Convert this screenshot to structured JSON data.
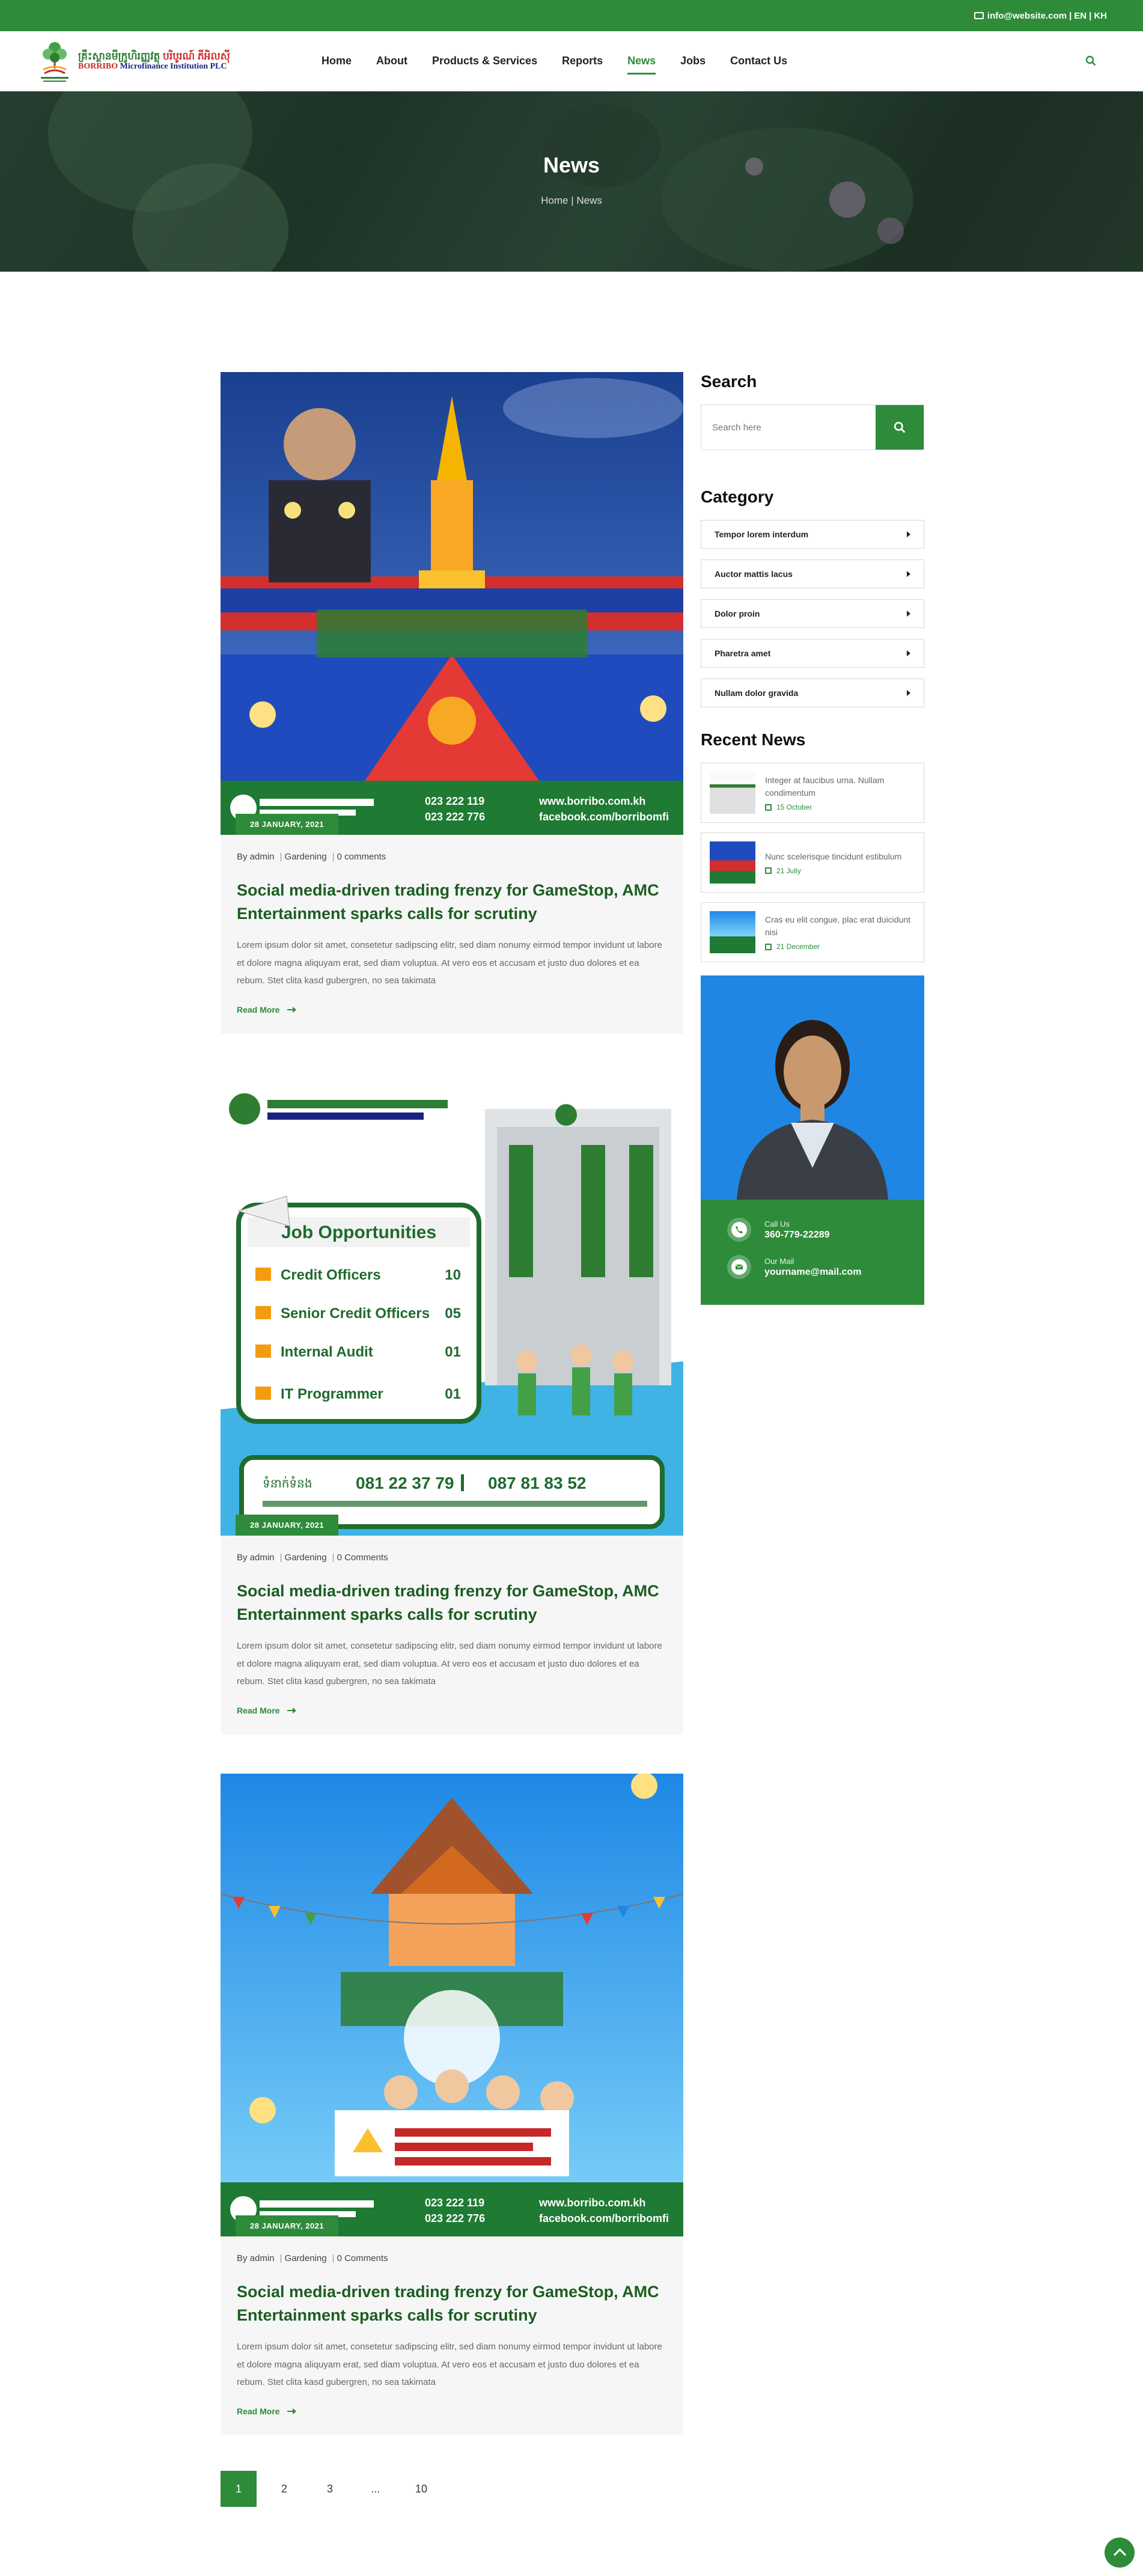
{
  "topbar": {
    "email": "info@website.com",
    "lang_en": "EN",
    "lang_kh": "KH",
    "separator": "|"
  },
  "logo": {
    "kh_text": "គ្រឹះស្ថានមីក្រូហិរញ្ញវត្ថុ",
    "kh_brand": "បរិបូរណ៍ ភីអិលស៊ី",
    "en_brand": "BORRIBO",
    "en_text": "Microfinance Institution PLC"
  },
  "nav": {
    "items": [
      "Home",
      "About",
      "Products & Services",
      "Reports",
      "News",
      "Jobs",
      "Contact Us"
    ],
    "active": "News"
  },
  "hero": {
    "title": "News",
    "breadcrumb": "Home | News"
  },
  "posts": [
    {
      "date": "28 JANUARY, 2021",
      "author": "By admin",
      "category": "Gardening",
      "comments": "0 comments",
      "title": "Social media-driven trading frenzy for GameStop, AMC Entertainment sparks calls for scrutiny",
      "excerpt": "Lorem ipsum dolor sit amet, consetetur sadipscing elitr, sed diam nonumy eirmod tempor invidunt ut labore et dolore magna aliquyam erat, sed diam voluptua. At vero eos et accusam et justo duo dolores et ea rebum. Stet clita kasd gubergren, no sea takimata",
      "read_more": "Read More",
      "image": {
        "phone1": "023 222 119",
        "phone2": "023 222 776",
        "web": "www.borribo.com.kh",
        "fb": "facebook.com/borribomfi"
      }
    },
    {
      "date": "28 JANUARY, 2021",
      "author": "By admin",
      "category": "Gardening",
      "comments": "0 Comments",
      "title": "Social media-driven trading frenzy for GameStop, AMC Entertainment sparks calls for scrutiny",
      "excerpt": "Lorem ipsum dolor sit amet, consetetur sadipscing elitr, sed diam nonumy eirmod tempor invidunt ut labore et dolore magna aliquyam erat, sed diam voluptua. At vero eos et accusam et justo duo dolores et ea rebum. Stet clita kasd gubergren, no sea takimata",
      "read_more": "Read More",
      "image": {
        "heading": "Job Opportunities",
        "jobs": [
          {
            "title": "Credit Officers",
            "count": "10"
          },
          {
            "title": "Senior Credit Officers",
            "count": "05"
          },
          {
            "title": "Internal Audit",
            "count": "01"
          },
          {
            "title": "IT Programmer",
            "count": "01"
          }
        ],
        "phone_label": "ទំនាក់ទំនង",
        "phone1": "081 22 37 79",
        "phone2": "087 81 83 52"
      }
    },
    {
      "date": "28 JANUARY, 2021",
      "author": "By admin",
      "category": "Gardening",
      "comments": "0 Comments",
      "title": "Social media-driven trading frenzy for GameStop, AMC Entertainment sparks calls for scrutiny",
      "excerpt": "Lorem ipsum dolor sit amet, consetetur sadipscing elitr, sed diam nonumy eirmod tempor invidunt ut labore et dolore magna aliquyam erat, sed diam voluptua. At vero eos et accusam et justo duo dolores et ea rebum. Stet clita kasd gubergren, no sea takimata",
      "read_more": "Read More",
      "image": {
        "phone1": "023 222 119",
        "phone2": "023 222 776",
        "web": "www.borribo.com.kh",
        "fb": "facebook.com/borribomfi"
      }
    }
  ],
  "pagination": [
    "1",
    "2",
    "3",
    "...",
    "10"
  ],
  "sidebar": {
    "search_title": "Search",
    "search_placeholder": "Search here",
    "category_title": "Category",
    "categories": [
      "Tempor lorem interdum",
      "Auctor mattis lacus",
      "Dolor proin",
      "Pharetra amet",
      "Nullam dolor gravida"
    ],
    "recent_title": "Recent News",
    "recent": [
      {
        "title": "Integer at faucibus urna. Nullam condimentum",
        "date": "15 October"
      },
      {
        "title": "Nunc scelerisque tincidunt estibulum",
        "date": "21 Jully"
      },
      {
        "title": "Cras eu elit congue, plac erat duicidunt nisi",
        "date": "21 December"
      }
    ],
    "contact": {
      "call_label": "Call Us",
      "call_value": "360-779-22289",
      "mail_label": "Our Mail",
      "mail_value": "yourname@mail.com"
    }
  },
  "colors": {
    "brand_green": "#2e8b3a",
    "title_green": "#1b5e20"
  }
}
